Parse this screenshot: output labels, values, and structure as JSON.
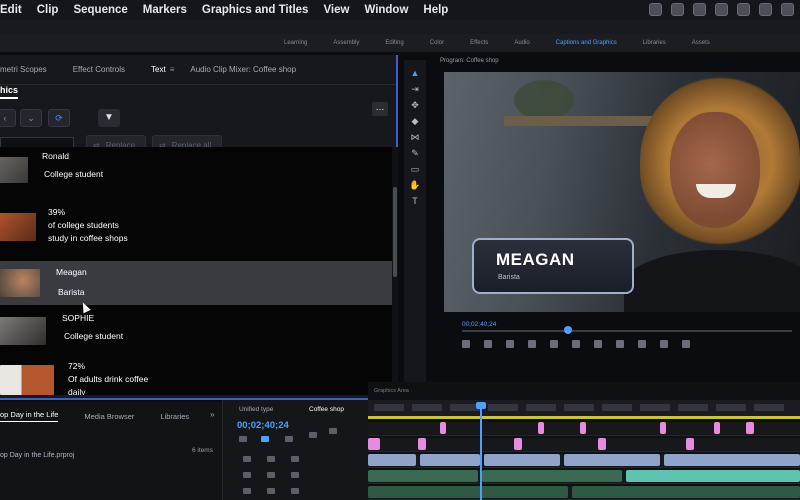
{
  "menubar": {
    "items": [
      "Edit",
      "Clip",
      "Sequence",
      "Markers",
      "Graphics and Titles",
      "View",
      "Window",
      "Help"
    ]
  },
  "workspaces": {
    "items": [
      "Learning",
      "Assembly",
      "Editing",
      "Color",
      "Effects",
      "Audio",
      "Captions and Graphics",
      "Libraries",
      "Assets"
    ],
    "active_index": 6
  },
  "left_panel": {
    "tabs": [
      "metri Scopes",
      "Effect Controls",
      "Text",
      "Audio Clip Mixer: Coffee shop"
    ],
    "active_tab_index": 2,
    "sub_tab": "hics",
    "replace_label": "Replace",
    "replace_all_label": "Replace all",
    "entries": [
      {
        "line1": "Ronald",
        "line2": "College student"
      },
      {
        "line1": "39%",
        "line2": "of college students",
        "line3": "study in coffee shops"
      },
      {
        "line1": "Meagan",
        "line2": "Barista",
        "selected": true
      },
      {
        "line1": "SOPHIE",
        "line2": "College student"
      },
      {
        "line1": "72%",
        "line2": "Of adults drink coffee",
        "line3": "daily"
      }
    ]
  },
  "program_monitor": {
    "label": "Program: Coffee shop",
    "lower_third_name": "MEAGAN",
    "lower_third_role": "Barista",
    "timecode": "00;02;40;24"
  },
  "project_panel": {
    "tabs": [
      "op Day in the Life",
      "Media Browser",
      "Libraries"
    ],
    "file_name": "op Day in the Life.prproj",
    "items_count": "6 items"
  },
  "sequence_panel": {
    "tabs": [
      "Unified type",
      "Coffee shop"
    ],
    "timecode": "00;02;40;24"
  },
  "timeline": {
    "header": "Graphics Area"
  },
  "colors": {
    "accent_blue": "#4ea0ff",
    "panel_border": "#3b5fc7",
    "work_area": "#c8c24a",
    "clip_pink": "#e58be0",
    "clip_teal": "#5fc3b1"
  }
}
